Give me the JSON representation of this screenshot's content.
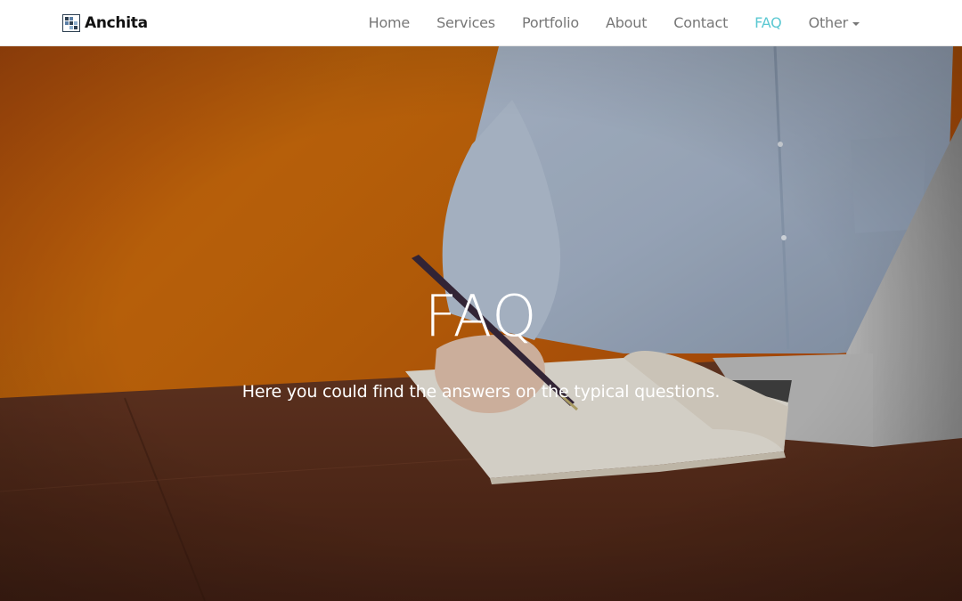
{
  "brand": {
    "name": "Anchita",
    "logo_icon": "grid-squares-logo-icon"
  },
  "nav": {
    "items": [
      {
        "label": "Home",
        "active": false
      },
      {
        "label": "Services",
        "active": false
      },
      {
        "label": "Portfolio",
        "active": false
      },
      {
        "label": "About",
        "active": false
      },
      {
        "label": "Contact",
        "active": false
      },
      {
        "label": "FAQ",
        "active": true
      },
      {
        "label": "Other",
        "active": false,
        "dropdown": true
      }
    ],
    "active_color": "#5bc8d2",
    "text_color": "#777777"
  },
  "hero": {
    "title": "FAQ",
    "subtitle": "Here you could find the answers on the typical questions.",
    "background": "photo of a person writing with a fountain pen in a notebook at a wooden desk next to a laptop, orange wall"
  }
}
